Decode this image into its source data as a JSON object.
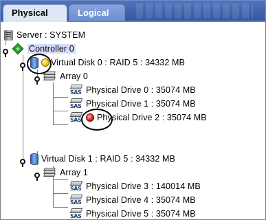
{
  "tabs": [
    {
      "label": "Physical",
      "active": true
    },
    {
      "label": "Logical",
      "active": false
    }
  ],
  "tree": {
    "server": "Server : SYSTEM",
    "controller": "Controller 0",
    "virtual_disks": [
      {
        "label": "Virtual Disk 0 : RAID 5 : 34332 MB",
        "status": "warning",
        "array": {
          "label": "Array 0",
          "drives": [
            {
              "label": "Physical Drive 0 : 35074 MB",
              "status": "ok"
            },
            {
              "label": "Physical Drive 1 : 35074 MB",
              "status": "ok"
            },
            {
              "label": "Physical Drive 2 : 35074 MB",
              "status": "failed"
            }
          ]
        }
      },
      {
        "label": "Virtual Disk 1 : RAID 5 : 34332 MB",
        "status": "ok",
        "array": {
          "label": "Array 1",
          "drives": [
            {
              "label": "Physical Drive 3 : 140014 MB",
              "status": "ok"
            },
            {
              "label": "Physical Drive 4 : 35074 MB",
              "status": "ok"
            },
            {
              "label": "Physical Drive 5 : 35074 MB",
              "status": "ok"
            }
          ]
        }
      }
    ]
  },
  "icon_text": {
    "sas": "SAS"
  },
  "colors": {
    "tab_bar": "#3f63ad",
    "selection": "#d6dcf7",
    "warning": "#f3c300",
    "failed": "#e11b1b"
  }
}
